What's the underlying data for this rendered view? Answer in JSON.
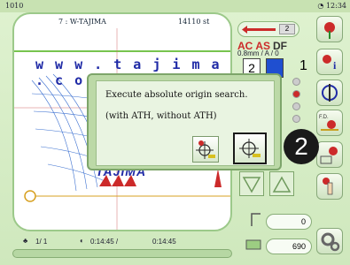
{
  "topbar": {
    "code": "1010",
    "time": "12:34"
  },
  "design": {
    "name": "7 : W-TAJIMA",
    "stitches": "14110 st",
    "url_text": "w w w . t a j i m a . c o m",
    "brand": "TAJIMA"
  },
  "status": {
    "needle": "2",
    "ac": "AC",
    "as": "AS",
    "df": "DF",
    "sub": "0.8mm  /  A  /  0",
    "frame_numbers": [
      "2",
      "1"
    ]
  },
  "dialog": {
    "line1": "Execute absolute origin search.",
    "line2": "(with ATH, without ATH)"
  },
  "badge": "2",
  "bottom": {
    "counter": "1/    1",
    "time1": "0:14:45 /",
    "time2": "0:14:45"
  },
  "fields": {
    "speed": "0",
    "count": "690"
  },
  "colors": {
    "bg": "#d9efc9",
    "accent_red": "#cc2a2a",
    "panel": "#ffffff",
    "blue": "#1f2aa6"
  }
}
